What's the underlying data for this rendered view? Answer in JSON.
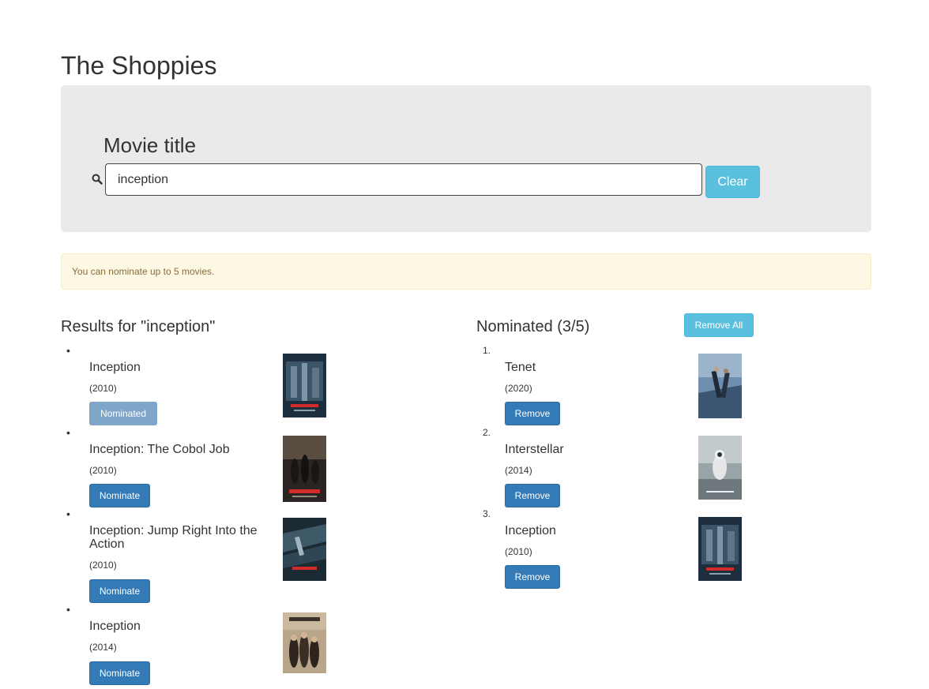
{
  "app": {
    "title": "The Shoppies"
  },
  "search": {
    "label": "Movie title",
    "value": "inception",
    "placeholder": "",
    "clear_label": "Clear"
  },
  "alert": {
    "text": "You can nominate up to 5 movies."
  },
  "results": {
    "heading": "Results for \"inception\"",
    "items": [
      {
        "title": "Inception",
        "year": "(2010)",
        "action_label": "Nominated",
        "nominated": true,
        "poster_icon": "inception-poster"
      },
      {
        "title": "Inception: The Cobol Job",
        "year": "(2010)",
        "action_label": "Nominate",
        "nominated": false,
        "poster_icon": "cobol-job-poster"
      },
      {
        "title": "Inception: Jump Right Into the Action",
        "year": "(2010)",
        "action_label": "Nominate",
        "nominated": false,
        "poster_icon": "jump-right-poster"
      },
      {
        "title": "Inception",
        "year": "(2014)",
        "action_label": "Nominate",
        "nominated": false,
        "poster_icon": "inception-2014-poster"
      }
    ]
  },
  "nominations": {
    "heading": "Nominated (3/5)",
    "remove_all_label": "Remove All",
    "items": [
      {
        "index": "1.",
        "title": "Tenet",
        "year": "(2020)",
        "action_label": "Remove",
        "poster_icon": "tenet-poster"
      },
      {
        "index": "2.",
        "title": "Interstellar",
        "year": "(2014)",
        "action_label": "Remove",
        "poster_icon": "interstellar-poster"
      },
      {
        "index": "3.",
        "title": "Inception",
        "year": "(2010)",
        "action_label": "Remove",
        "poster_icon": "inception-poster"
      }
    ]
  },
  "colors": {
    "panel_bg": "#eaeaea",
    "info_button": "#5bc0de",
    "primary_button": "#337ab7",
    "disabled_button": "#7fa5c9",
    "alert_bg": "#fcf8e3",
    "alert_text": "#8a6d3b"
  }
}
